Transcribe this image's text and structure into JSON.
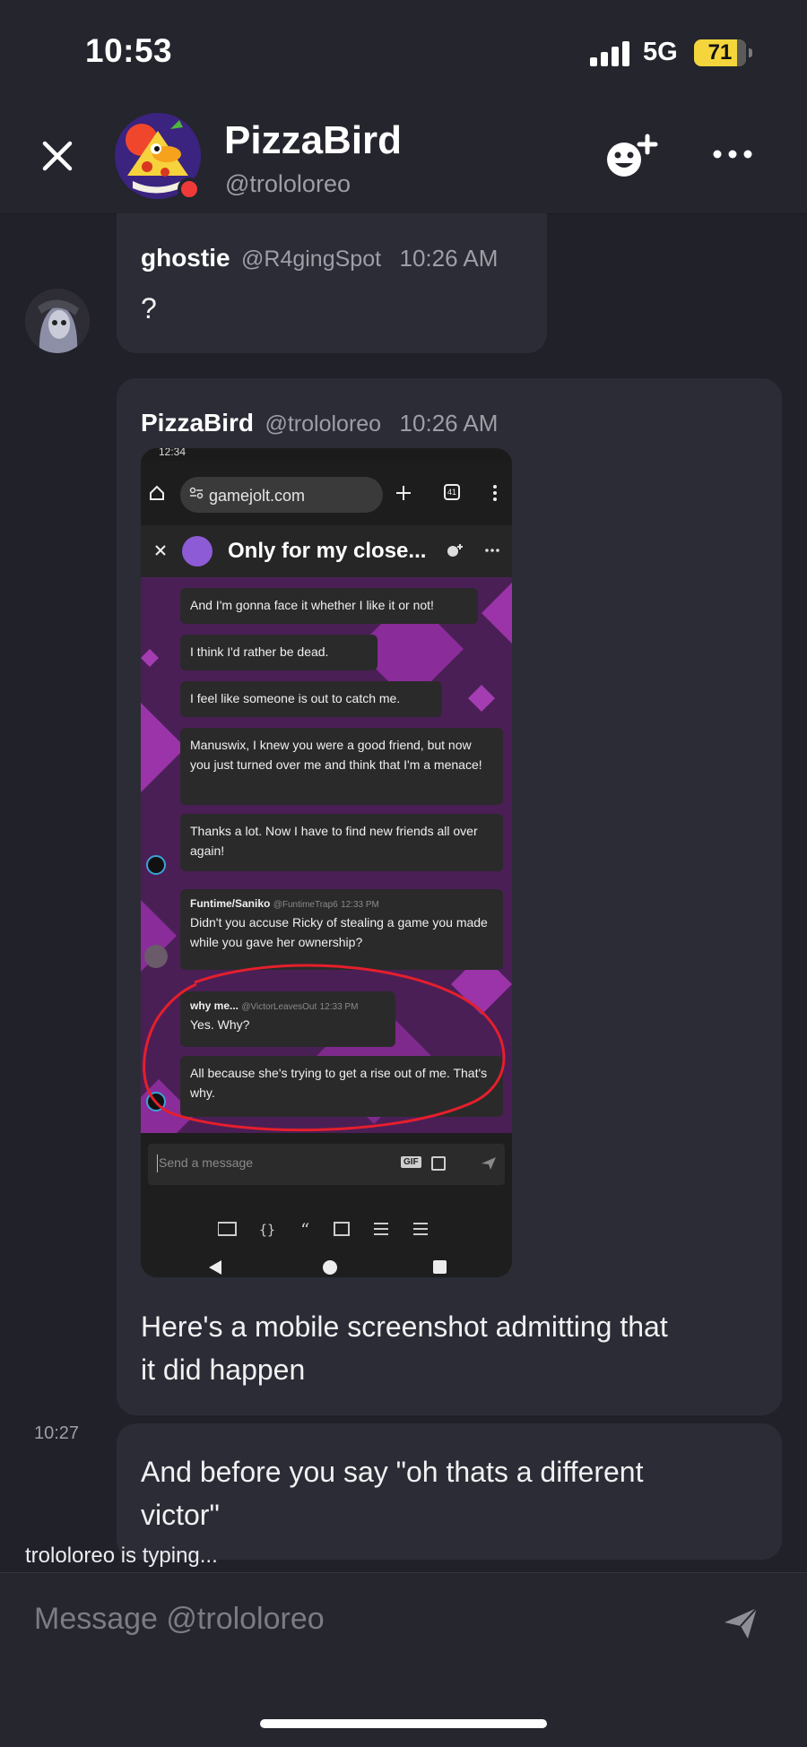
{
  "status_bar": {
    "time": "10:53",
    "network": "5G",
    "battery": "71"
  },
  "header": {
    "name": "PizzaBird",
    "handle": "@trololoreo"
  },
  "messages": [
    {
      "name": "ghostie",
      "handle": "@R4gingSpot",
      "time": "10:26 AM",
      "text": "?"
    },
    {
      "name": "PizzaBird",
      "handle": "@trololoreo",
      "time": "10:26 AM",
      "text_line1": "Here's a mobile screenshot admitting that",
      "text_line2": "it did happen"
    },
    {
      "time": "10:27",
      "text_line1": "And before you say \"oh thats a different",
      "text_line2": "victor\""
    }
  ],
  "screenshot": {
    "status_time": "12:34",
    "url": "gamejolt.com",
    "tab_count": "41",
    "chat_title": "Only for my close...",
    "bubbles": [
      "And I'm gonna face it whether I like it or not!",
      "I think I'd rather be dead.",
      "I feel like someone is out to catch me.",
      "Manuswix, I knew you were a good friend, but now you just turned over me and think that I'm a menace!",
      "Thanks a lot. Now I have to find new friends all over again!"
    ],
    "funtime": {
      "name": "Funtime/Saniko",
      "handle": "@FuntimeTrap6",
      "time": "12:33 PM",
      "text": "Didn't you accuse Ricky of stealing a game you made while you gave her ownership?"
    },
    "whyme": {
      "name": "why me...",
      "handle": "@VictorLeavesOut",
      "time": "12:33 PM",
      "text": "Yes. Why?"
    },
    "last_bubble": "All because she's trying to get a rise out of me. That's why.",
    "input_placeholder": "Send a message",
    "gif_label": "GIF"
  },
  "typing_indicator": "trololoreo is typing...",
  "composer": {
    "placeholder": "Message @trololoreo"
  },
  "colors": {
    "background": "#202129",
    "bubble": "#2b2c35",
    "battery": "#f4d53b",
    "online_dot": "#f03a3a",
    "annotation": "#e51f2c"
  },
  "icons": [
    "close-icon",
    "add-friend-icon",
    "more-icon",
    "send-icon",
    "signal-icon",
    "battery-icon"
  ]
}
